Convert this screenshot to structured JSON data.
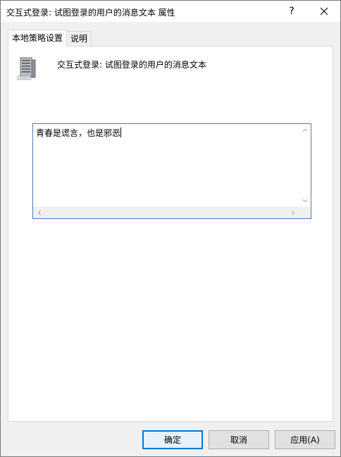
{
  "window": {
    "title": "交互式登录: 试图登录的用户的消息文本 属性",
    "help_label": "?"
  },
  "tabs": [
    {
      "label": "本地策略设置",
      "active": true
    },
    {
      "label": "说明",
      "active": false
    }
  ],
  "policy": {
    "icon": "server-icon",
    "name": "交互式登录: 试图登录的用户的消息文本"
  },
  "message_text": {
    "value": "青春是谎言，也是邪恶"
  },
  "buttons": {
    "ok": "确定",
    "cancel": "取消",
    "apply": "应用(A)"
  },
  "colors": {
    "focus_border": "#0078d7",
    "textbox_border": "#4d7ab8"
  }
}
